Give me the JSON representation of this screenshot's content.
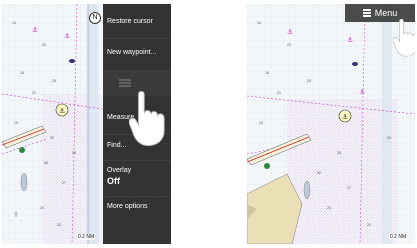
{
  "left_panel": {
    "scale": "0.2 NM",
    "menu": {
      "restore_cursor": "Restore cursor",
      "new_waypoint": "New waypoint...",
      "measure": "Measure",
      "find": "Find...",
      "overlay_label": "Overlay",
      "overlay_value": "Off",
      "more_options": "More options"
    }
  },
  "right_panel": {
    "scale": "0.2 NM",
    "menu_button": {
      "icon": "hamburger-icon",
      "label": "Menu"
    }
  },
  "colors": {
    "water": "#f3f7fa",
    "menu_bg": "#232323",
    "magenta": "#cc33cc"
  }
}
